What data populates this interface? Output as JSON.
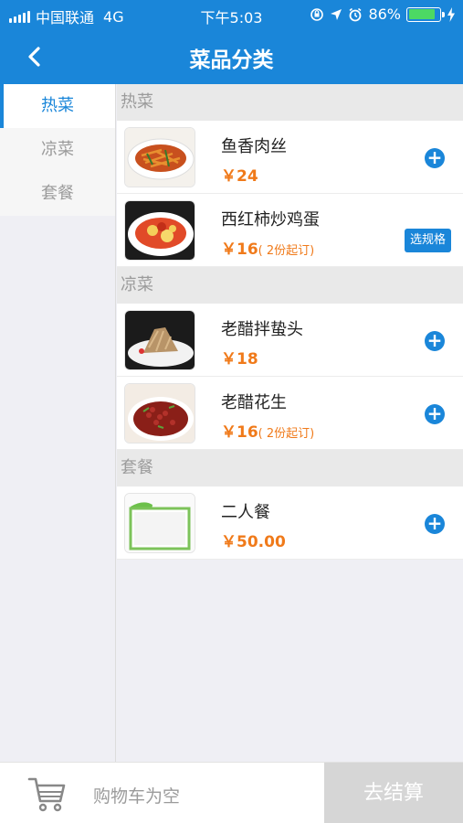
{
  "status_bar": {
    "carrier": "中国联通",
    "network": "4G",
    "time": "下午5:03",
    "battery_percent": "86%",
    "battery_level": 0.86,
    "icons": [
      "signal-icon",
      "orientation-lock-icon",
      "location-icon",
      "alarm-icon",
      "battery-icon",
      "charging-icon"
    ]
  },
  "nav": {
    "title": "菜品分类",
    "back_icon": "chevron-left-icon"
  },
  "sidebar": {
    "items": [
      {
        "label": "热菜",
        "active": true
      },
      {
        "label": "凉菜",
        "active": false
      },
      {
        "label": "套餐",
        "active": false
      }
    ]
  },
  "sections": [
    {
      "title": "热菜",
      "dishes": [
        {
          "name": "鱼香肉丝",
          "price": "￥24",
          "min_order": "",
          "action": "add",
          "image": "shredded-pork-photo"
        },
        {
          "name": "西红柿炒鸡蛋",
          "price": "￥16",
          "min_order": "( 2份起订)",
          "action": "选规格",
          "image": "tomato-egg-photo"
        }
      ]
    },
    {
      "title": "凉菜",
      "dishes": [
        {
          "name": "老醋拌蛰头",
          "price": "￥18",
          "min_order": "",
          "action": "add",
          "image": "jellyfish-salad-photo"
        },
        {
          "name": "老醋花生",
          "price": "￥16",
          "min_order": "( 2份起订)",
          "action": "add",
          "image": "vinegar-peanuts-photo"
        }
      ]
    },
    {
      "title": "套餐",
      "dishes": [
        {
          "name": "二人餐",
          "price": "￥50.00",
          "min_order": "",
          "action": "add",
          "image": "combo-placeholder-image"
        }
      ]
    }
  ],
  "cart": {
    "empty_text": "购物车为空",
    "checkout_label": "去结算",
    "icon": "cart-icon"
  },
  "colors": {
    "primary": "#1a86d9",
    "price": "#f07a1a",
    "muted": "#9b9b9b",
    "battery": "#4cd964"
  }
}
